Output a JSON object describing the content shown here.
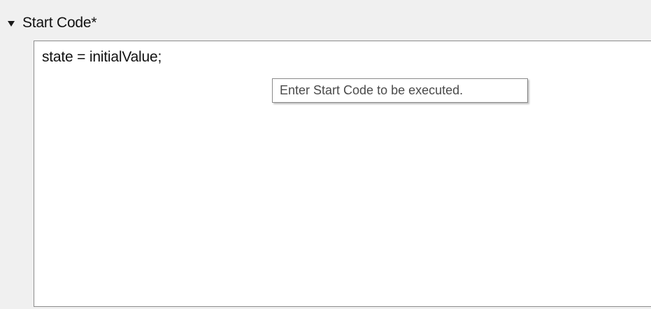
{
  "section": {
    "title": "Start Code*",
    "toggle_icon": "caret-down-icon",
    "expanded": true
  },
  "editor": {
    "code": "state = initialValue;"
  },
  "tooltip": {
    "text": "Enter Start Code to be executed."
  }
}
